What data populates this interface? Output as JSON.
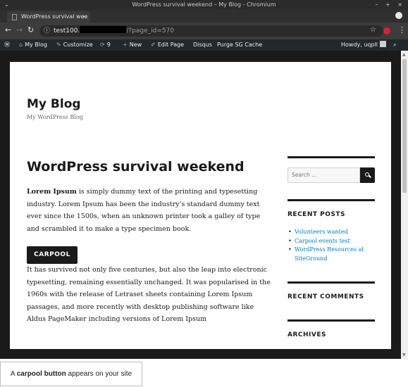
{
  "browser": {
    "window_title": "WordPress survival weekend – My Blog - Chromium",
    "tab_title": "WordPress survival wee",
    "url_prefix": "test100.",
    "url_path": "/?page_id=570"
  },
  "admin_bar": {
    "site_name": "My Blog",
    "customize": "Customize",
    "updates_count": "9",
    "new": "New",
    "edit_page": "Edit Page",
    "disqus": "Disqus",
    "purge": "Purge SG Cache",
    "howdy": "Howdy, uqpll"
  },
  "site": {
    "title": "My Blog",
    "description": "My WordPress Blog"
  },
  "post": {
    "title": "WordPress survival weekend",
    "para1_bold": "Lorem Ipsum",
    "para1_rest": " is simply dummy text of the printing and typesetting industry. Lorem Ipsum has been the industry’s standard dummy text ever since the 1500s, when an unknown printer took a galley of type and scrambled it to make a type specimen book.",
    "button_label": "CARPOOL",
    "para2": "It has survived not only five centuries, but also the leap into electronic typesetting, remaining essentially unchanged. It was popularised in the 1960s with the release of Letraset sheets containing Lorem Ipsum passages, and more recently with desktop publishing software like Aldus PageMaker including versions of Lorem Ipsum"
  },
  "sidebar": {
    "search_placeholder": "Search ...",
    "recent_posts_title": "RECENT POSTS",
    "recent_posts": [
      "Volunteers wanted",
      "Carpool events test",
      "WordPress Resources at SiteGround"
    ],
    "recent_comments_title": "RECENT COMMENTS",
    "archives_title": "ARCHIVES"
  },
  "caption": {
    "prefix": "A ",
    "bold": "carpool button",
    "suffix": " appears on your site"
  }
}
